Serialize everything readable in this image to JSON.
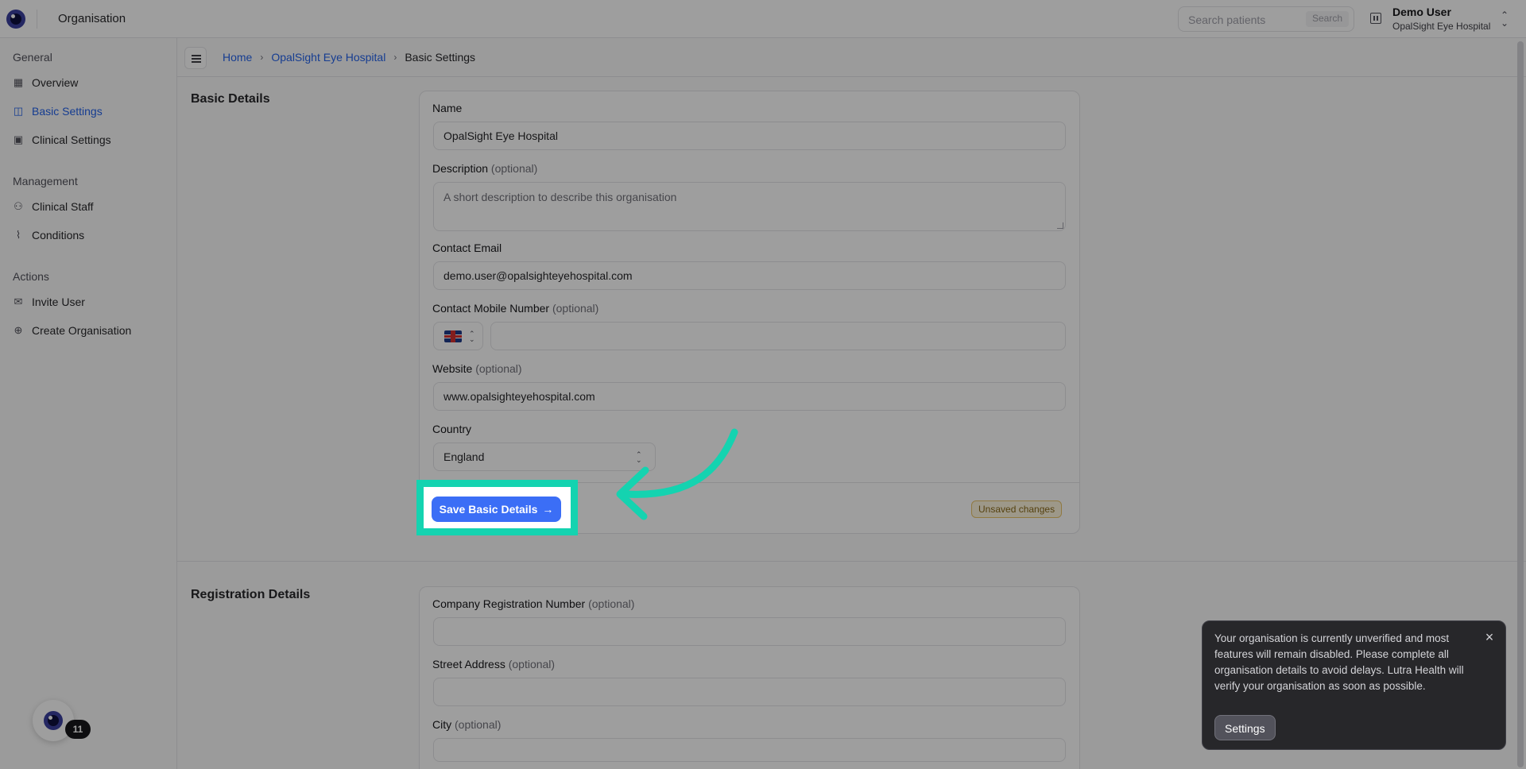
{
  "topbar": {
    "app_title": "Organisation",
    "search_placeholder": "Search patients",
    "search_button": "Search",
    "user_name": "Demo User",
    "user_org": "OpalSight Eye Hospital"
  },
  "sidebar": {
    "sections": [
      {
        "title": "General",
        "items": [
          {
            "label": "Overview",
            "icon": "grid-icon"
          },
          {
            "label": "Basic Settings",
            "icon": "settings-panel-icon",
            "active": true
          },
          {
            "label": "Clinical Settings",
            "icon": "clinical-doc-icon"
          }
        ]
      },
      {
        "title": "Management",
        "items": [
          {
            "label": "Clinical Staff",
            "icon": "users-icon"
          },
          {
            "label": "Conditions",
            "icon": "activity-icon"
          }
        ]
      },
      {
        "title": "Actions",
        "items": [
          {
            "label": "Invite User",
            "icon": "mail-icon"
          },
          {
            "label": "Create Organisation",
            "icon": "plus-circle-icon"
          }
        ]
      }
    ],
    "notification_count": "11"
  },
  "breadcrumb": {
    "home": "Home",
    "org": "OpalSight Eye Hospital",
    "current": "Basic Settings"
  },
  "basic_details": {
    "title": "Basic Details",
    "name_label": "Name",
    "name_value": "OpalSight Eye Hospital",
    "description_label": "Description",
    "description_placeholder": "A short description to describe this organisation",
    "optional": "(optional)",
    "email_label": "Contact Email",
    "email_value": "demo.user@opalsighteyehospital.com",
    "mobile_label": "Contact Mobile Number",
    "mobile_value": "",
    "website_label": "Website",
    "website_value": "www.opalsighteyehospital.com",
    "country_label": "Country",
    "country_value": "England",
    "save_button": "Save Basic Details",
    "unsaved_badge": "Unsaved changes"
  },
  "registration_details": {
    "title": "Registration Details",
    "company_reg_label": "Company Registration Number",
    "street_label": "Street Address",
    "city_label": "City",
    "optional": "(optional)"
  },
  "toast": {
    "message": "Your organisation is currently unverified and most features will remain disabled. Please complete all organisation details to avoid delays. Lutra Health will verify your organisation as soon as possible.",
    "button": "Settings"
  },
  "colors": {
    "accent": "#2563eb",
    "primary_button": "#3b6ef6",
    "highlight": "#14d3b0"
  }
}
